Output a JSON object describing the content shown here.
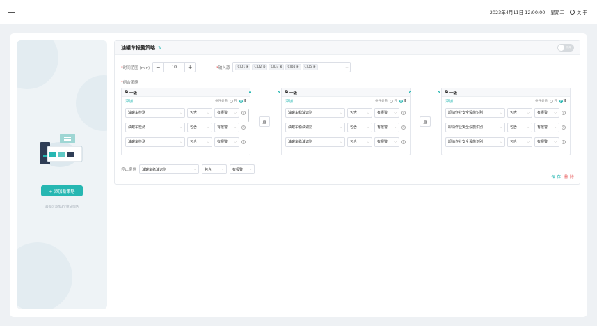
{
  "header": {
    "datetime": "2023年4月11日 12:00:00",
    "weekday": "星期二",
    "about_label": "关 于"
  },
  "sidebar": {
    "add_button_label": "+ 添加新策略",
    "hint": "最多可添加3个算法策略"
  },
  "strategy": {
    "title": "油罐车报警策略",
    "toggle_text": "停用",
    "time_label": "时间范围 (min)",
    "time_value": "10",
    "source_label": "输入源",
    "sources": [
      "CID1",
      "CID2",
      "CID3",
      "CID4",
      "CID5"
    ],
    "combo_label": "组合策略",
    "relation_between": "且",
    "groups": [
      {
        "title": "一级",
        "add": "添加",
        "relation_label": "条件关系",
        "and_label": "且",
        "or_label": "或",
        "rows": [
          {
            "target": "油罐车检测",
            "op": "包含",
            "value": "有报警"
          },
          {
            "target": "油罐车检测",
            "op": "包含",
            "value": "有报警"
          },
          {
            "target": "油罐车检测",
            "op": "包含",
            "value": "有报警"
          }
        ]
      },
      {
        "title": "一级",
        "add": "添加",
        "relation_label": "条件关系",
        "and_label": "且",
        "or_label": "或",
        "rows": [
          {
            "target": "油罐车稳油识别",
            "op": "包含",
            "value": "有报警"
          },
          {
            "target": "油罐车稳油识别",
            "op": "包含",
            "value": "有报警"
          },
          {
            "target": "油罐车稳油识别",
            "op": "包含",
            "value": "有报警"
          }
        ]
      },
      {
        "title": "一级",
        "add": "添加",
        "relation_label": "条件关系",
        "and_label": "且",
        "or_label": "或",
        "rows": [
          {
            "target": "卸油作业安全设施识别",
            "op": "包含",
            "value": "有报警"
          },
          {
            "target": "卸油作业安全设施识别",
            "op": "包含",
            "value": "有报警"
          },
          {
            "target": "卸油作业安全设施识别",
            "op": "包含",
            "value": "有报警"
          }
        ]
      }
    ],
    "stop": {
      "label": "停止条件",
      "target": "油罐车稳油识别",
      "op": "包含",
      "value": "有报警"
    },
    "save_label": "保 存",
    "delete_label": "删 除"
  },
  "colors": {
    "accent": "#26b7b2",
    "danger": "#e64b4b"
  }
}
